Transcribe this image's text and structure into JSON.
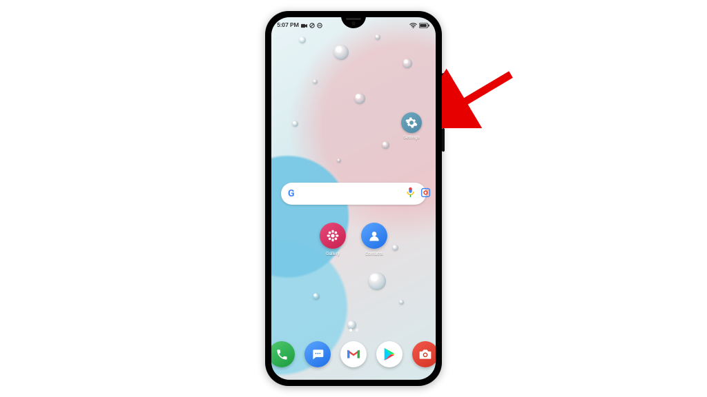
{
  "status_bar": {
    "time": "5:07 PM",
    "icons_left": [
      "video-icon",
      "no-sim-icon",
      "dnd-icon"
    ],
    "icons_right": [
      "wifi-icon",
      "battery-icon"
    ]
  },
  "home": {
    "settings_shortcut": {
      "label": "Settings",
      "icon": "gear-icon"
    },
    "search": {
      "placeholder": "",
      "provider": "Google",
      "actions": [
        "mic-icon",
        "lens-icon"
      ]
    },
    "mid_apps": [
      {
        "label": "Gallery",
        "icon": "gallery-icon",
        "bg": "bg-gallery"
      },
      {
        "label": "Contacts",
        "icon": "contacts-icon",
        "bg": "bg-contacts"
      }
    ],
    "page_indicator": {
      "count": 2,
      "active": 0
    },
    "dock": [
      {
        "label": "Phone",
        "icon": "phone-icon",
        "bg": "bg-phone"
      },
      {
        "label": "Messages",
        "icon": "messages-icon",
        "bg": "bg-msg"
      },
      {
        "label": "Gmail",
        "icon": "gmail-icon",
        "bg": "bg-gmail"
      },
      {
        "label": "Play Store",
        "icon": "play-icon",
        "bg": "bg-play"
      },
      {
        "label": "Camera",
        "icon": "camera-icon",
        "bg": "bg-camera"
      }
    ]
  },
  "hardware_buttons": [
    "volume-rocker",
    "power-button"
  ],
  "annotation": {
    "type": "arrow",
    "points_to": "settings-shortcut",
    "color": "#e60000"
  }
}
